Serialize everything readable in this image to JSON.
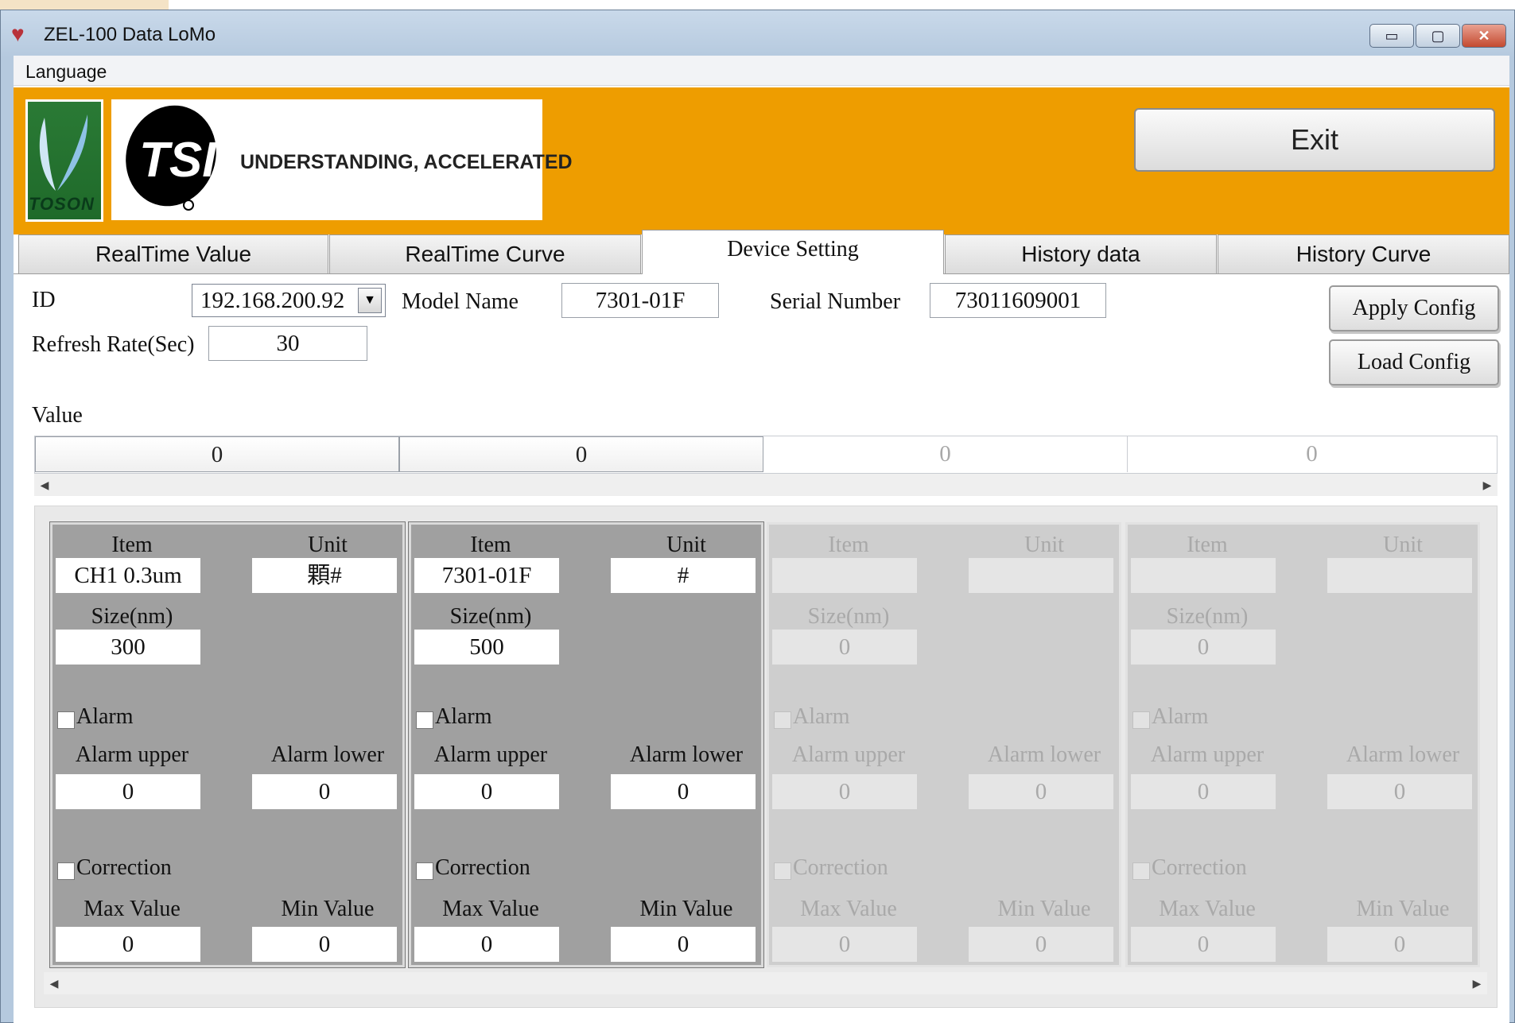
{
  "window": {
    "title": "ZEL-100 Data LoMo",
    "controls": {
      "minimize": "▭",
      "maximize": "▢",
      "close": "✕"
    }
  },
  "menu": {
    "language": "Language"
  },
  "banner": {
    "toson_text": "TOSON",
    "tsi_slogan": "UNDERSTANDING, ACCELERATED",
    "exit_label": "Exit"
  },
  "tabs": [
    {
      "label": "RealTime Value",
      "active": false
    },
    {
      "label": "RealTime Curve",
      "active": false
    },
    {
      "label": "Device Setting",
      "active": true
    },
    {
      "label": "History data",
      "active": false
    },
    {
      "label": "History Curve",
      "active": false
    }
  ],
  "settings": {
    "id_label": "ID",
    "id_value": "192.168.200.92",
    "model_label": "Model Name",
    "model_value": "7301-01F",
    "serial_label": "Serial Number",
    "serial_value": "73011609001",
    "refresh_label": "Refresh Rate(Sec)",
    "refresh_value": "30",
    "apply_label": "Apply Config",
    "load_label": "Load Config",
    "value_label": "Value"
  },
  "values": [
    "0",
    "0",
    "0",
    "0"
  ],
  "channel_labels": {
    "item": "Item",
    "unit": "Unit",
    "size": "Size(nm)",
    "alarm": "Alarm",
    "alarm_upper": "Alarm upper",
    "alarm_lower": "Alarm lower",
    "correction": "Correction",
    "max_value": "Max Value",
    "min_value": "Min Value"
  },
  "channels": [
    {
      "enabled": true,
      "item": "CH1 0.3um",
      "unit": "顆#",
      "size": "300",
      "alarm_upper": "0",
      "alarm_lower": "0",
      "max_value": "0",
      "min_value": "0"
    },
    {
      "enabled": true,
      "item": "7301-01F",
      "unit": "#",
      "size": "500",
      "alarm_upper": "0",
      "alarm_lower": "0",
      "max_value": "0",
      "min_value": "0"
    },
    {
      "enabled": false,
      "item": "",
      "unit": "",
      "size": "0",
      "alarm_upper": "0",
      "alarm_lower": "0",
      "max_value": "0",
      "min_value": "0"
    },
    {
      "enabled": false,
      "item": "",
      "unit": "",
      "size": "0",
      "alarm_upper": "0",
      "alarm_lower": "0",
      "max_value": "0",
      "min_value": "0"
    }
  ],
  "colors": {
    "banner": "#ee9d00",
    "active_channel": "#a0a0a0",
    "inactive_channel": "#cecece"
  }
}
